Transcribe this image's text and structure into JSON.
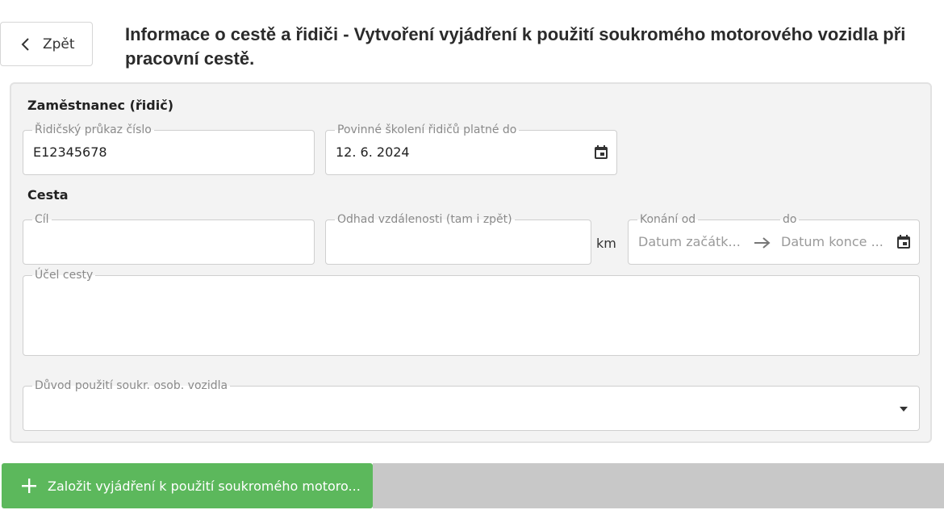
{
  "header": {
    "back_label": "Zpět",
    "title": "Informace o cestě a řidiči - Vytvoření vyjádření k použití soukromého motorového vozidla při pracovní cestě."
  },
  "employee_section": {
    "title": "Zaměstnanec (řidič)",
    "license": {
      "label": "Řidičský průkaz číslo",
      "value": "E12345678"
    },
    "training": {
      "label": "Povinné školení řidičů platné do",
      "value": "12. 6. 2024"
    }
  },
  "trip_section": {
    "title": "Cesta",
    "destination": {
      "label": "Cíl",
      "value": ""
    },
    "distance": {
      "label": "Odhad vzdálenosti (tam i zpět)",
      "value": "",
      "unit": "km"
    },
    "date_from": {
      "label": "Konání od",
      "placeholder": "Datum začátk..."
    },
    "date_to": {
      "label": "do",
      "placeholder": "Datum konce ..."
    },
    "purpose": {
      "label": "Účel cesty",
      "value": ""
    },
    "reason": {
      "label": "Důvod použití soukr. osob. vozidla",
      "value": ""
    }
  },
  "footer": {
    "create_label": "Založit vyjádření k použití soukromého motoro..."
  },
  "colors": {
    "accent_green": "#5cb85c",
    "panel_bg": "#f3f3f3",
    "footer_bar": "#c8c8c8"
  },
  "icons": [
    "chevron-left-icon",
    "calendar-icon",
    "arrow-right-icon",
    "caret-down-icon",
    "plus-icon"
  ]
}
